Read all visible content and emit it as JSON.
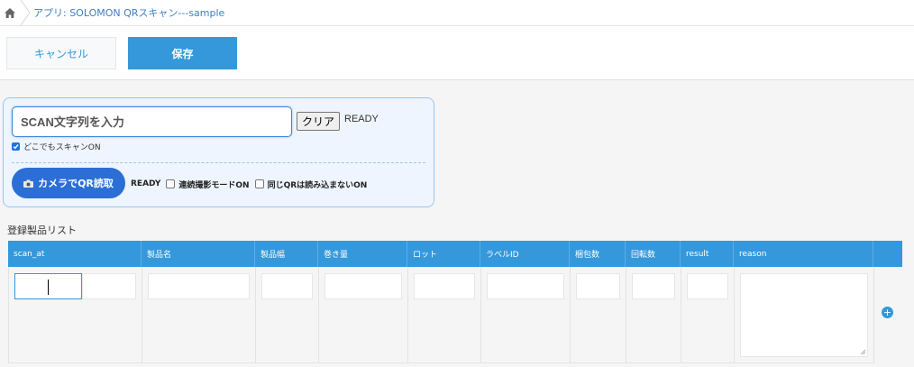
{
  "breadcrumb": {
    "home_icon": "home-icon",
    "app_label": "アプリ: SOLOMON QRスキャン---sample"
  },
  "actions": {
    "cancel_label": "キャンセル",
    "save_label": "保存"
  },
  "scan": {
    "input_placeholder": "SCAN文字列を入力",
    "clear_label": "クリア",
    "status": "READY",
    "anywhere_label": "どこでもスキャンON",
    "anywhere_checked": true,
    "camera_label": "カメラでQR読取",
    "camera_status": "READY",
    "continuous_label": "連続撮影モードON",
    "skip_same_label": "同じQRは読み込まないON"
  },
  "list": {
    "title": "登録製品リスト",
    "columns": [
      "scan_at",
      "製品名",
      "製品幅",
      "巻き量",
      "ロット",
      "ラベルID",
      "梱包数",
      "回転数",
      "result",
      "reason"
    ]
  },
  "colors": {
    "accent": "#3498db",
    "camera_button": "#2b6fd6",
    "panel_bg": "#eef5fe"
  }
}
